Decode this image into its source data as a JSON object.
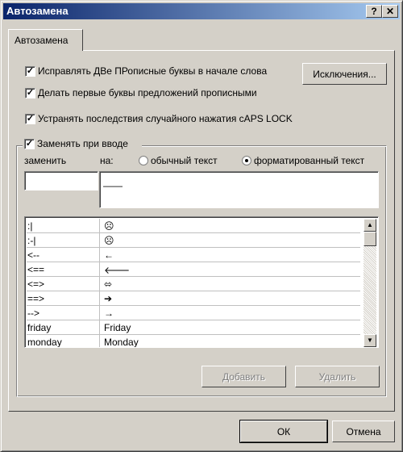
{
  "window": {
    "title": "Автозамена",
    "help_label": "?",
    "close_label": "✕"
  },
  "tab": {
    "label": "Автозамена"
  },
  "options": {
    "two_caps": {
      "label": "Исправлять ДВе ПРописные буквы в начале слова",
      "checked": "✓"
    },
    "sentence_caps": {
      "label": "Делать первые буквы предложений прописными",
      "checked": "✓"
    },
    "caps_lock": {
      "label": "Устранять последствия случайного нажатия cAPS LOCK",
      "checked": "✓"
    },
    "replace_as_you_type": {
      "label": "Заменять при вводе",
      "checked": "✓"
    }
  },
  "buttons": {
    "exceptions": "Исключения...",
    "add": "Добавить",
    "delete": "Удалить",
    "ok": "ОК",
    "cancel": "Отмена"
  },
  "replace": {
    "replace_label": "заменить",
    "with_label": "на:",
    "plain_text_label": "обычный текст",
    "formatted_text_label": "форматированный текст",
    "selected": "formatted",
    "replace_value": "",
    "with_value": "——"
  },
  "entries": [
    {
      "from": ":|",
      "to": "☹"
    },
    {
      "from": ":-|",
      "to": "☹"
    },
    {
      "from": "<--",
      "to": "←"
    },
    {
      "from": "<==",
      "to": "🡐"
    },
    {
      "from": "<=>",
      "to": "⬄"
    },
    {
      "from": "==>",
      "to": "➔"
    },
    {
      "from": "-->",
      "to": "→"
    },
    {
      "from": "friday",
      "to": "Friday"
    },
    {
      "from": "monday",
      "to": "Monday"
    }
  ]
}
